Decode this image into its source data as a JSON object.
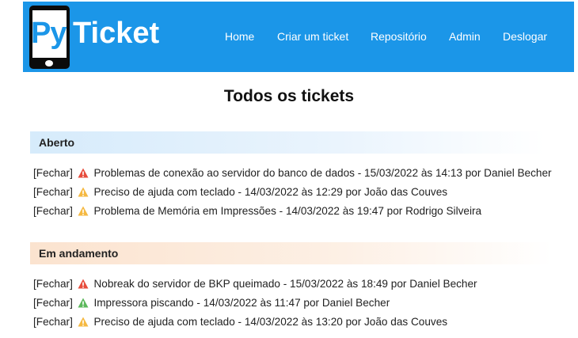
{
  "navbar": {
    "logo_py": "Py",
    "logo_ticket": "Ticket",
    "links": [
      "Home",
      "Criar um ticket",
      "Repositório",
      "Admin",
      "Deslogar"
    ]
  },
  "page_title": "Todos os tickets",
  "sections": [
    {
      "title": "Aberto",
      "tickets": [
        {
          "close": "[Fechar]",
          "priority_icon": "alert-triangle-red",
          "text": "Problemas de conexão ao servidor do banco de dados - 15/03/2022 às 14:13 por Daniel Becher"
        },
        {
          "close": "[Fechar]",
          "priority_icon": "alert-triangle-yellow",
          "text": "Preciso de ajuda com teclado - 14/03/2022 às 12:29 por João das Couves"
        },
        {
          "close": "[Fechar]",
          "priority_icon": "alert-triangle-yellow",
          "text": "Problema de Memória em Impressões - 14/03/2022 às 19:47 por Rodrigo Silveira"
        }
      ]
    },
    {
      "title": "Em andamento",
      "tickets": [
        {
          "close": "[Fechar]",
          "priority_icon": "alert-triangle-red",
          "text": "Nobreak do servidor de BKP queimado - 15/03/2022 às 18:49 por Daniel Becher"
        },
        {
          "close": "[Fechar]",
          "priority_icon": "alert-triangle-green",
          "text": "Impressora piscando - 14/03/2022 às 11:47 por Daniel Becher"
        },
        {
          "close": "[Fechar]",
          "priority_icon": "alert-triangle-yellow",
          "text": "Preciso de ajuda com teclado - 14/03/2022 às 13:20 por João das Couves"
        }
      ]
    }
  ],
  "colors": {
    "navbar": "#1b96e8",
    "priority_red": "#e74c3c",
    "priority_yellow": "#f5b942",
    "priority_green": "#5cb85c"
  }
}
